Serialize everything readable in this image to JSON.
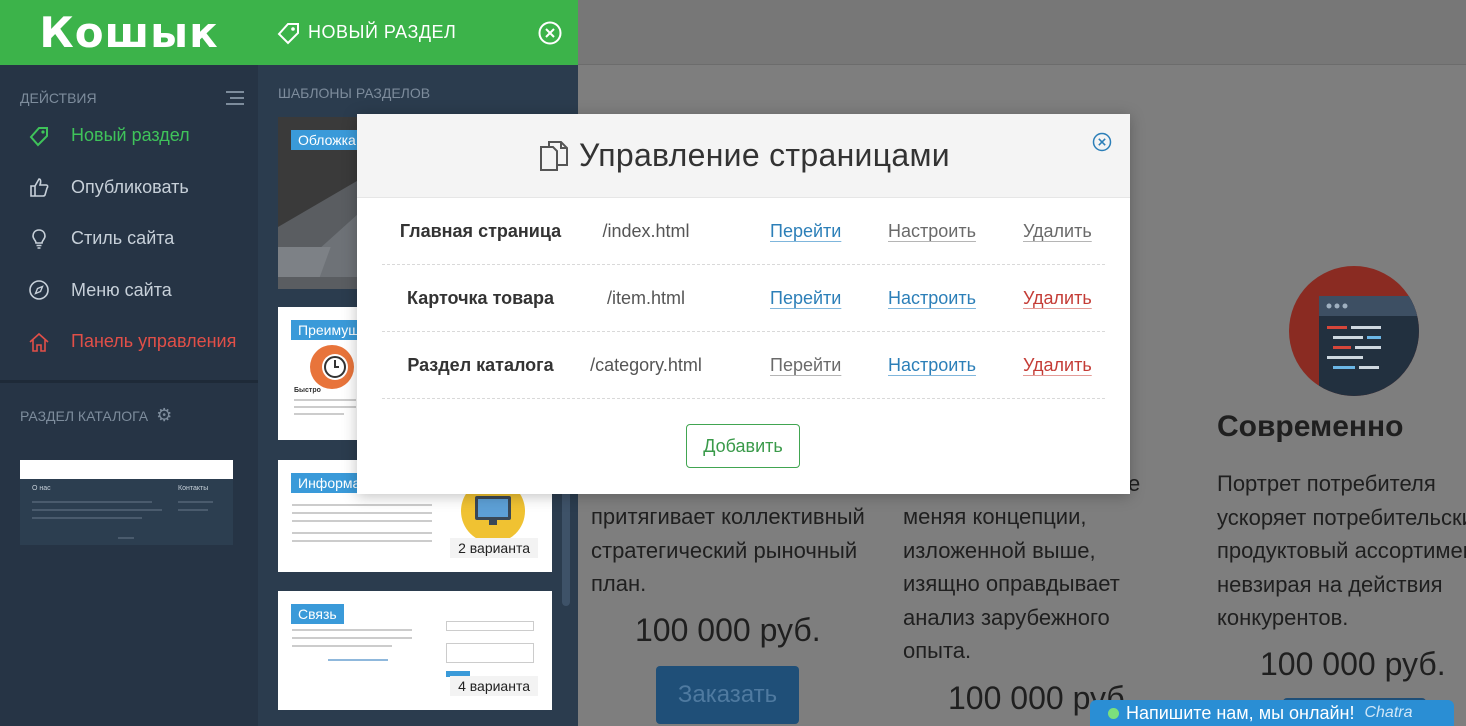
{
  "sidebar": {
    "logo": "Кошык",
    "actions_title": "ДЕЙСТВИЯ",
    "items": [
      {
        "label": "Новый раздел",
        "icon": "tag-icon"
      },
      {
        "label": "Опубликовать",
        "icon": "thumbs-up-icon"
      },
      {
        "label": "Стиль сайта",
        "icon": "lightbulb-icon"
      },
      {
        "label": "Меню сайта",
        "icon": "compass-icon"
      },
      {
        "label": "Панель управления",
        "icon": "home-icon"
      }
    ],
    "catalog_title": "РАЗДЕЛ КАТАЛОГА",
    "catalog_thumb": {
      "col1": "О нас",
      "col2": "Контакты"
    }
  },
  "templates": {
    "header": "НОВЫЙ РАЗДЕЛ",
    "section_title": "ШАБЛОНЫ РАЗДЕЛОВ",
    "cards": [
      {
        "label": "Обложка",
        "variants": ""
      },
      {
        "label": "Преимущ",
        "variants": ""
      },
      {
        "label": "Информа",
        "variants": "2 варианта"
      },
      {
        "label": "Связь",
        "variants": "4 варианта"
      }
    ],
    "card2_caption": "Быстро"
  },
  "background_page": {
    "col1": {
      "text": [
        "притягивает коллективный",
        "стратегический рыночный",
        "план."
      ],
      "price": "100 000 руб.",
      "button": "Заказать"
    },
    "col2": {
      "text": [
        "меняя концепции,",
        "изложенной выше,",
        "изящно оправдывает",
        "анализ зарубежного",
        "опыта."
      ],
      "price": "100 000 руб.",
      "partial_top": "е"
    },
    "col3": {
      "title": "Современно",
      "text": [
        "Портрет потребителя",
        "ускоряет потребительски",
        "продуктовый ассортимен",
        "невзирая на действия",
        "конкурентов."
      ],
      "price": "100 000 руб."
    }
  },
  "modal": {
    "title": "Управление страницами",
    "pages": [
      {
        "name": "Главная страница",
        "url": "/index.html",
        "go": "Перейти",
        "configure": "Настроить",
        "delete": "Удалить"
      },
      {
        "name": "Карточка товара",
        "url": "/item.html",
        "go": "Перейти",
        "configure": "Настроить",
        "delete": "Удалить"
      },
      {
        "name": "Раздел каталога",
        "url": "/category.html",
        "go": "Перейти",
        "configure": "Настроить",
        "delete": "Удалить"
      }
    ],
    "add_button": "Добавить"
  },
  "chat": {
    "text": "Напишите нам, мы онлайн!",
    "brand": "Chatra"
  },
  "colors": {
    "brand_green": "#3cb34a",
    "sidebar_bg": "#263445",
    "link_blue": "#2c7fb8",
    "danger_red": "#c43c36"
  }
}
